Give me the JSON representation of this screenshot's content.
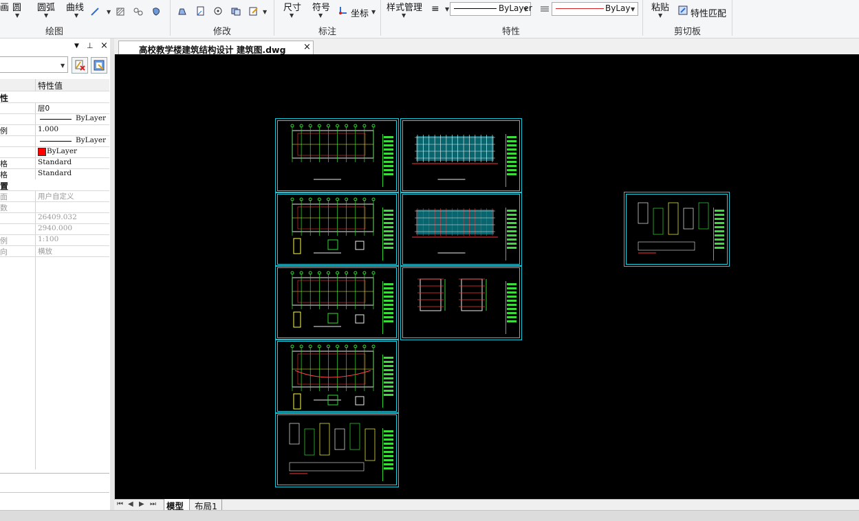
{
  "ribbon": {
    "draw": {
      "circle": "圆",
      "arc": "圆弧",
      "curve": "曲线",
      "group": "绘图"
    },
    "modify": {
      "group": "修改"
    },
    "annotate": {
      "dimension": "尺寸",
      "symbol": "符号",
      "coordinate": "坐标",
      "group": "标注"
    },
    "properties": {
      "style_manager": "样式管理",
      "linetype": "ByLayer",
      "color": "ByLaye",
      "group": "特性"
    },
    "clipboard": {
      "paste": "粘贴",
      "match": "特性匹配",
      "group": "剪切板"
    },
    "colors": {
      "color_line": "#d62020"
    }
  },
  "panel": {
    "header_col": "特性值",
    "rows": [
      {
        "key": "性",
        "value": "",
        "section": true
      },
      {
        "key": "",
        "value": "层0"
      },
      {
        "key": "",
        "value": "ByLayer",
        "line": true
      },
      {
        "key": "例",
        "value": "1.000"
      },
      {
        "key": "",
        "value": "ByLayer",
        "line": true
      },
      {
        "key": "",
        "value": "ByLayer",
        "swatch": "#ff0000"
      },
      {
        "key": "格",
        "value": "Standard"
      },
      {
        "key": "格",
        "value": "Standard"
      },
      {
        "key": "置",
        "value": "",
        "section": true
      },
      {
        "key": "面",
        "value": "用户自定义",
        "grey": true
      },
      {
        "key": "数",
        "value": "",
        "grey": true
      },
      {
        "key": "",
        "value": "26409.032",
        "grey": true
      },
      {
        "key": "",
        "value": "2940.000",
        "grey": true
      },
      {
        "key": "例",
        "value": "1:100",
        "grey": true
      },
      {
        "key": "向",
        "value": "横放",
        "grey": true
      }
    ]
  },
  "document": {
    "tab_title": "高校教学楼建筑结构设计 建筑图.dwg"
  },
  "layout_tabs": {
    "model": "模型",
    "layout1": "布局1"
  }
}
